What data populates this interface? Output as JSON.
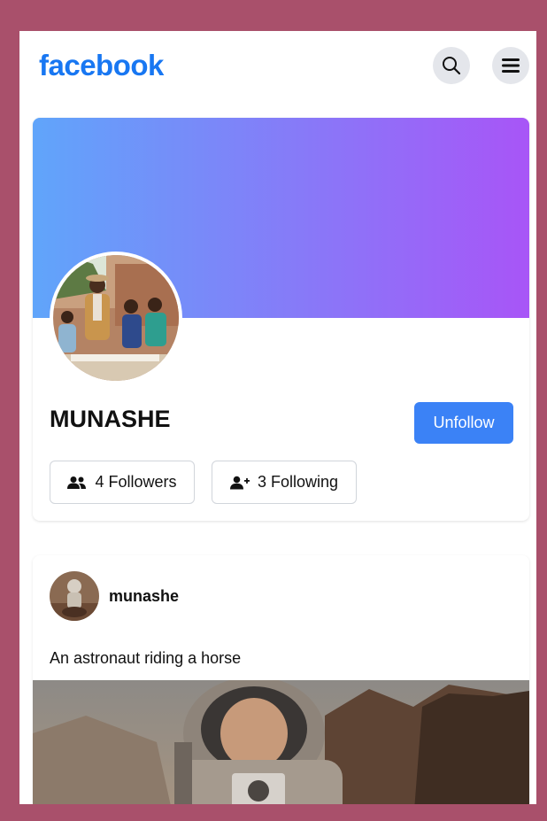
{
  "app": {
    "logo_text": "facebook",
    "brand_color": "#1877f2"
  },
  "header": {
    "search_icon": "search-icon",
    "menu_icon": "menu-icon"
  },
  "profile": {
    "name": "MUNASHE",
    "action_label": "Unfollow",
    "followers_label": "4 Followers",
    "following_label": "3 Following",
    "cover_gradient": [
      "#60a5fa",
      "#a855f7"
    ],
    "action_color": "#3b82f6"
  },
  "post": {
    "author": "munashe",
    "text": "An astronaut riding a horse"
  }
}
